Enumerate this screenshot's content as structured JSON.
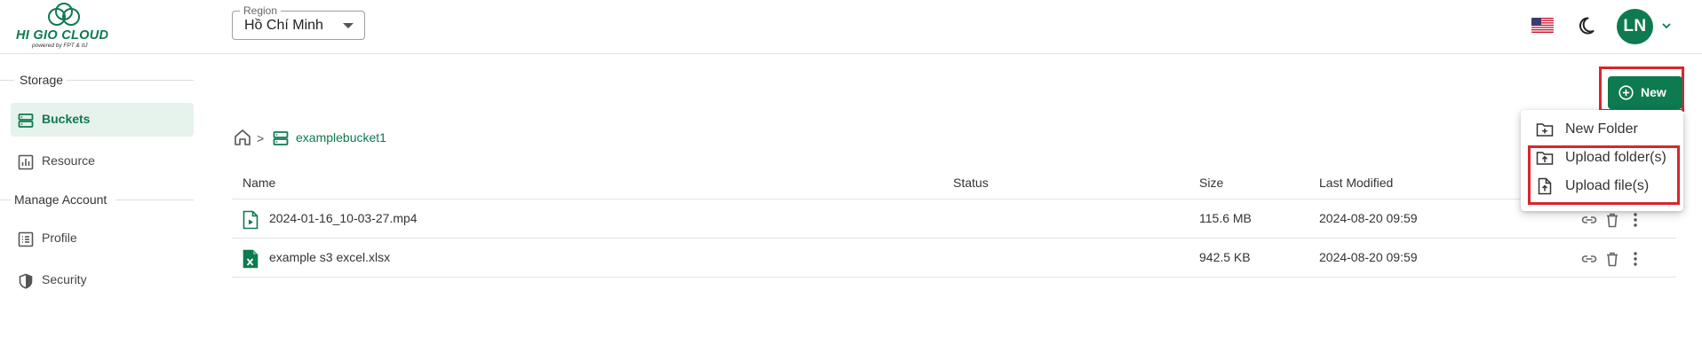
{
  "brand": {
    "name": "HI GIO CLOUD",
    "tagline": "powered by FPT & IIJ",
    "accent": "#0e7a4f"
  },
  "header": {
    "region_label": "Region",
    "region_value": "Hồ Chí Minh",
    "language_icon": "us-flag-icon",
    "theme_icon": "moon-icon",
    "avatar_initials": "LN"
  },
  "sidebar": {
    "sections": [
      {
        "label": "Storage"
      },
      {
        "label": "Manage Account"
      }
    ],
    "items": [
      {
        "label": "Buckets",
        "icon": "bucket-icon",
        "active": true
      },
      {
        "label": "Resource",
        "icon": "chart-icon",
        "active": false
      },
      {
        "label": "Profile",
        "icon": "profile-list-icon",
        "active": false
      },
      {
        "label": "Security",
        "icon": "shield-icon",
        "active": false
      }
    ]
  },
  "toolbar": {
    "new_label": "New"
  },
  "breadcrumb": {
    "separator": ">",
    "bucket": "examplebucket1"
  },
  "table": {
    "columns": [
      "Name",
      "Status",
      "Size",
      "Last Modified"
    ],
    "rows": [
      {
        "name": "2024-01-16_10-03-27.mp4",
        "status": "",
        "size": "115.6 MB",
        "modified": "2024-08-20 09:59",
        "icon": "video-file-icon"
      },
      {
        "name": "example s3 excel.xlsx",
        "status": "",
        "size": "942.5 KB",
        "modified": "2024-08-20 09:59",
        "icon": "excel-file-icon"
      }
    ]
  },
  "menu": {
    "items": [
      {
        "label": "New Folder",
        "icon": "new-folder-icon"
      },
      {
        "label": "Upload folder(s)",
        "icon": "upload-folder-icon"
      },
      {
        "label": "Upload file(s)",
        "icon": "upload-file-icon"
      }
    ]
  },
  "colors": {
    "primary": "#0e7a4f",
    "active_bg": "#e6f2ec",
    "highlight": "#d9262c"
  }
}
